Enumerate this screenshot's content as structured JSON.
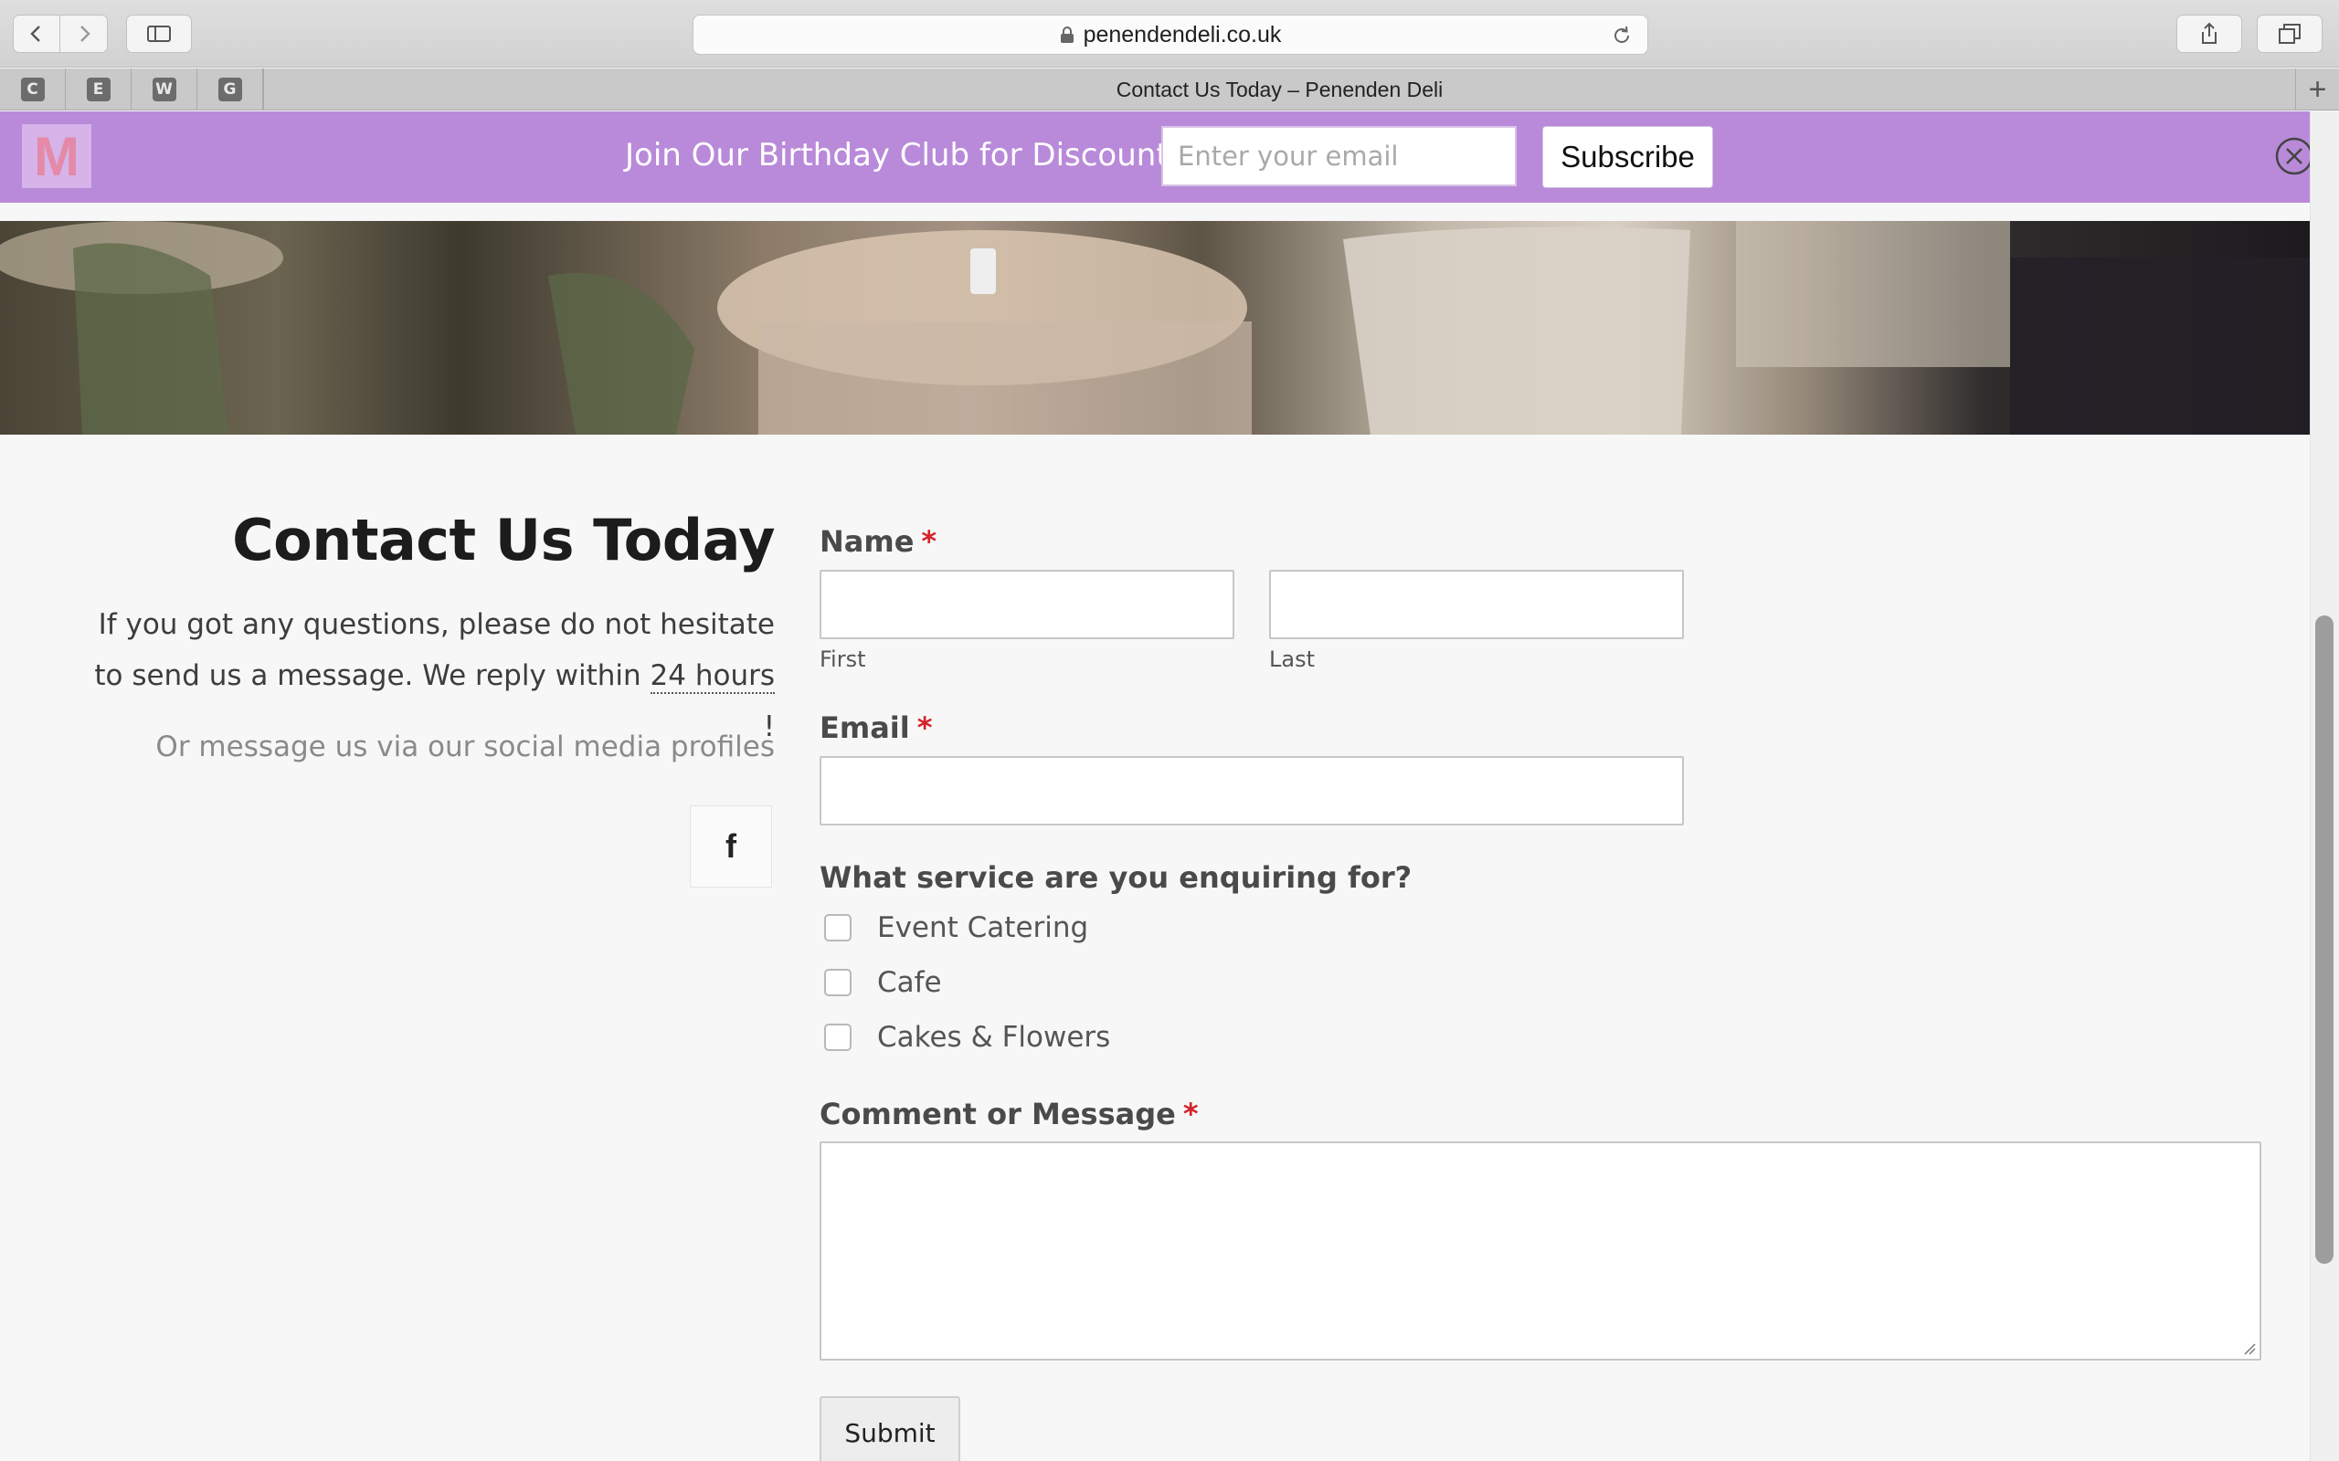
{
  "browser": {
    "url": "penendendeli.co.uk",
    "tab_title": "Contact Us Today – Penenden Deli",
    "favorites": [
      "C",
      "E",
      "W",
      "G"
    ],
    "new_tab": "+"
  },
  "promo": {
    "logo": "M",
    "text": "Join Our Birthday Club for Discounts!",
    "email_placeholder": "Enter your email",
    "subscribe_label": "Subscribe"
  },
  "contact": {
    "heading": "Contact Us Today",
    "intro_part1": "If you got any questions, please do not hesitate to send us a message. We reply within ",
    "intro_hours": "24 hours",
    "intro_part2": " !",
    "social_text": "Or message us via our social media profiles",
    "facebook_glyph": "f"
  },
  "form": {
    "name_label": "Name",
    "required_mark": "*",
    "first_label": "First",
    "last_label": "Last",
    "email_label": "Email",
    "service_label": "What service are you enquiring for?",
    "services": [
      "Event Catering",
      "Cafe",
      "Cakes & Flowers"
    ],
    "message_label": "Comment or Message",
    "submit_label": "Submit"
  },
  "colors": {
    "promo_bg": "#b98ad9",
    "required": "#d3232a",
    "page_bg": "#f7f7f7"
  }
}
